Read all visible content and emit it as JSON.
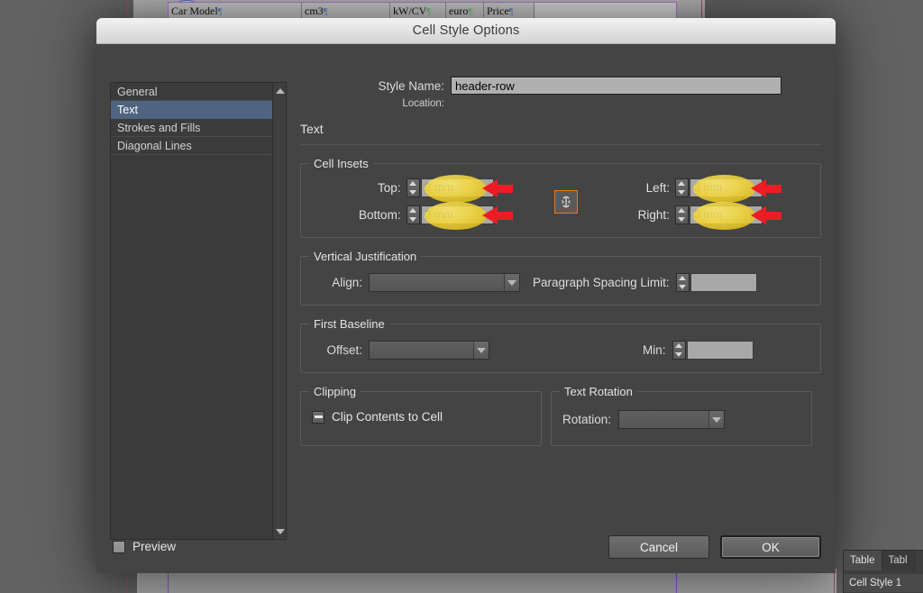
{
  "background": {
    "table_cells": [
      {
        "text": "Car Model",
        "mark": "pilcrow"
      },
      {
        "text": "cm3",
        "mark": "pilcrow"
      },
      {
        "text": "kW/CV",
        "mark": "pilcrow-green"
      },
      {
        "text": "euro",
        "mark": "pilcrow-green"
      },
      {
        "text": "Price",
        "mark": "pilcrow"
      },
      {
        "text": "",
        "mark": ""
      }
    ]
  },
  "dialog": {
    "title": "Cell Style Options",
    "sidebar": {
      "items": [
        {
          "label": "General",
          "selected": false
        },
        {
          "label": "Text",
          "selected": true
        },
        {
          "label": "Strokes and Fills",
          "selected": false
        },
        {
          "label": "Diagonal Lines",
          "selected": false
        }
      ],
      "scroll_up_icon": "triangle-up-icon",
      "scroll_down_icon": "triangle-down-icon"
    },
    "style_name": {
      "label": "Style Name:",
      "value": "header-row",
      "placeholder": ""
    },
    "location": {
      "label": "Location:",
      "value": ""
    },
    "section_heading": "Text",
    "cell_insets": {
      "legend": "Cell Insets",
      "top": {
        "label": "Top:",
        "value": "3 mm"
      },
      "bottom": {
        "label": "Bottom:",
        "value": "3 mm"
      },
      "left": {
        "label": "Left:",
        "value": "3 mm"
      },
      "right": {
        "label": "Right:",
        "value": "3 mm"
      },
      "link_icon": "link-chain-icon",
      "link_active_color": "#e07b20",
      "highlight_color": "#f5d93c",
      "annotation_arrow_color": "#ed1c24"
    },
    "vertical_justification": {
      "legend": "Vertical Justification",
      "align": {
        "label": "Align:",
        "value": ""
      },
      "paragraph_spacing_limit": {
        "label": "Paragraph Spacing Limit:",
        "value": ""
      }
    },
    "first_baseline": {
      "legend": "First Baseline",
      "offset": {
        "label": "Offset:",
        "value": ""
      },
      "min": {
        "label": "Min:",
        "value": ""
      }
    },
    "clipping": {
      "legend": "Clipping",
      "clip_contents": {
        "label": "Clip Contents to Cell",
        "state": "mixed"
      }
    },
    "text_rotation": {
      "legend": "Text Rotation",
      "rotation": {
        "label": "Rotation:",
        "value": ""
      }
    },
    "footer": {
      "preview_label": "Preview",
      "preview_checked": false,
      "cancel_label": "Cancel",
      "ok_label": "OK"
    }
  },
  "side_panel": {
    "tabs": [
      {
        "label": "Table",
        "active": true
      },
      {
        "label": "Tabl",
        "active": false
      }
    ],
    "row_label": "Cell Style 1"
  }
}
